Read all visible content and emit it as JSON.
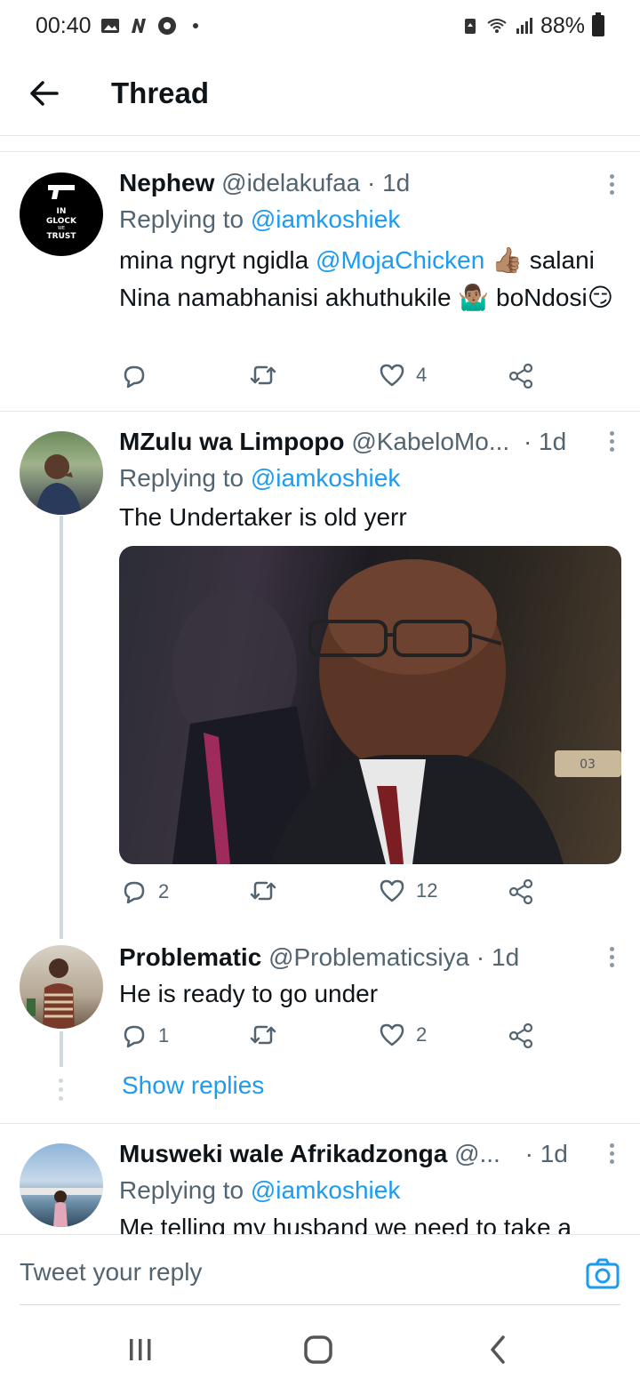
{
  "status_bar": {
    "time": "00:40",
    "icons": [
      "gallery-icon",
      "n-icon",
      "chrome-icon",
      "notification-dot-icon"
    ],
    "right_icons": [
      "battery-saver-icon",
      "wifi-icon",
      "signal-icon"
    ],
    "battery": "88%"
  },
  "header": {
    "title": "Thread",
    "back_icon": "arrow-left-icon"
  },
  "tweets": [
    {
      "name": "Nephew",
      "handle": "@idelakufaa",
      "dot": "·",
      "time": "1d",
      "replying_prefix": "Replying to ",
      "replying_to": "@iamkoshiek",
      "text_before": "mina ngryt ngidla ",
      "text_mention": "@MojaChicken",
      "text_after": " 👍🏽 salani Nina namabhanisi akhuthukile 🤷🏽‍♂️ boNdosi😏",
      "avatar_text": [
        "IN",
        "GLOCK",
        "WE",
        "TRUST"
      ],
      "replies": "",
      "retweets": "",
      "likes": "4"
    },
    {
      "name": "MZulu wa Limpopo",
      "handle": "@KabeloMo...",
      "dot": "·",
      "time": "1d",
      "replying_prefix": "Replying to ",
      "replying_to": "@iamkoshiek",
      "text": "The Undertaker is old yerr",
      "image_label": "03",
      "replies": "2",
      "retweets": "",
      "likes": "12"
    },
    {
      "name": "Problematic",
      "handle": "@Problematicsiya",
      "dot": "·",
      "time": "1d",
      "text": "He is ready to go under",
      "replies": "1",
      "retweets": "",
      "likes": "2"
    },
    {
      "name": "Musweki wale Afrikadzonga",
      "handle": "@...",
      "dot": "·",
      "time": "1d",
      "replying_prefix": "Replying to ",
      "replying_to": "@iamkoshiek",
      "text": "Me telling my husband we need to take a"
    }
  ],
  "show_replies": "Show replies",
  "reply_bar": {
    "placeholder": "Tweet your reply",
    "camera_icon": "camera-icon"
  },
  "nav": {
    "recents_icon": "recents-icon",
    "home_icon": "home-icon",
    "back_icon": "back-icon"
  },
  "colors": {
    "accent": "#1d9bf0",
    "muted": "#536471",
    "text": "#0f1419",
    "divider": "#e6e6e6"
  }
}
